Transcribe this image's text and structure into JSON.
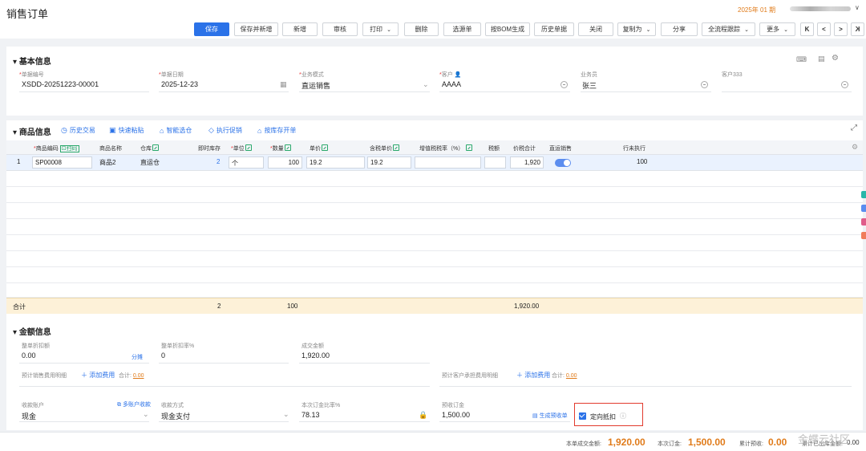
{
  "header": {
    "title": "销售订单",
    "period": "2025年 01 期",
    "user_caret": "∨"
  },
  "toolbar": {
    "buttons": [
      {
        "label": "保存"
      },
      {
        "label": "保存并新增"
      },
      {
        "label": "新增"
      },
      {
        "label": "审核"
      },
      {
        "label": "打印"
      },
      {
        "label": "删除"
      },
      {
        "label": "选源单"
      },
      {
        "label": "按BOM生成"
      },
      {
        "label": "历史单据"
      },
      {
        "label": "关闭"
      },
      {
        "label": "复制为"
      },
      {
        "label": "分享"
      },
      {
        "label": "全流程跟踪"
      },
      {
        "label": "更多"
      }
    ],
    "nav": [
      "K",
      "<",
      ">",
      "K"
    ]
  },
  "basic": {
    "title": "基本信息",
    "fields": [
      {
        "label": "单据编号",
        "value": "XSDD-20251223-00001"
      },
      {
        "label": "单据日期",
        "value": "2025-12-23"
      },
      {
        "label": "业务模式",
        "value": "直运销售"
      },
      {
        "label": "客户",
        "value": "AAAA"
      },
      {
        "label": "业务员",
        "value": "张三"
      },
      {
        "label": "客户333",
        "value": ""
      }
    ]
  },
  "goods": {
    "title": "商品信息",
    "tools": [
      "历史交易",
      "快速粘贴",
      "智能选仓",
      "执行促销",
      "按库存开单"
    ],
    "columns": [
      "商品编码",
      "扫码",
      "商品名称",
      "仓库",
      "即时库存",
      "单位",
      "数量",
      "单价",
      "含税单价",
      "增值税税率（%）",
      "税额",
      "价税合计",
      "直运销售",
      "行未执行"
    ],
    "rows": [
      {
        "idx": "1",
        "code": "SP00008",
        "name": "商品2",
        "warehouse": "直运仓",
        "stock": "2",
        "unit": "个",
        "qty": "100",
        "price": "19.2",
        "tax_price": "19.2",
        "tax_rate": "",
        "tax": "",
        "total": "1,920",
        "direct": true,
        "unexec": "100"
      }
    ],
    "totals": {
      "label": "合计",
      "stock": "2",
      "qty": "100",
      "total": "1,920.00"
    }
  },
  "amount": {
    "title": "金额信息",
    "discount_amount": {
      "label": "整单折扣额",
      "value": "0.00",
      "link": "分摊"
    },
    "discount_rate": {
      "label": "整单折扣率%",
      "value": "0"
    },
    "deal_amount": {
      "label": "成交金额",
      "value": "1,920.00"
    },
    "sales_fee": {
      "label": "预计销售费用明细",
      "add": "添加费用",
      "subtotal_label": "合计:",
      "subtotal": "0.00"
    },
    "customer_fee": {
      "label": "预计客户承担费用明细",
      "add": "添加费用",
      "subtotal_label": "合计:",
      "subtotal": "0.00"
    },
    "account": {
      "label": "收款账户",
      "value": "现金",
      "link": "多账户收款"
    },
    "method": {
      "label": "收款方式",
      "value": "现金支付"
    },
    "deposit_ratio": {
      "label": "本次订金比率%",
      "value": "78.13"
    },
    "advance": {
      "label": "预收订金",
      "value": "1,500.00",
      "link": "生成预收单"
    },
    "directed_offset": {
      "label": "定向抵扣",
      "checked": true
    }
  },
  "footer": {
    "deal_label": "本单成交金额:",
    "deal_value": "1,920.00",
    "deposit_label": "本次订金:",
    "deposit_value": "1,500.00",
    "cum_label": "累计预收:",
    "cum_value": "0.00",
    "tail_label": "累计已出库金额:",
    "tail_value": "0.00",
    "watermark": "金蝶云社区"
  }
}
